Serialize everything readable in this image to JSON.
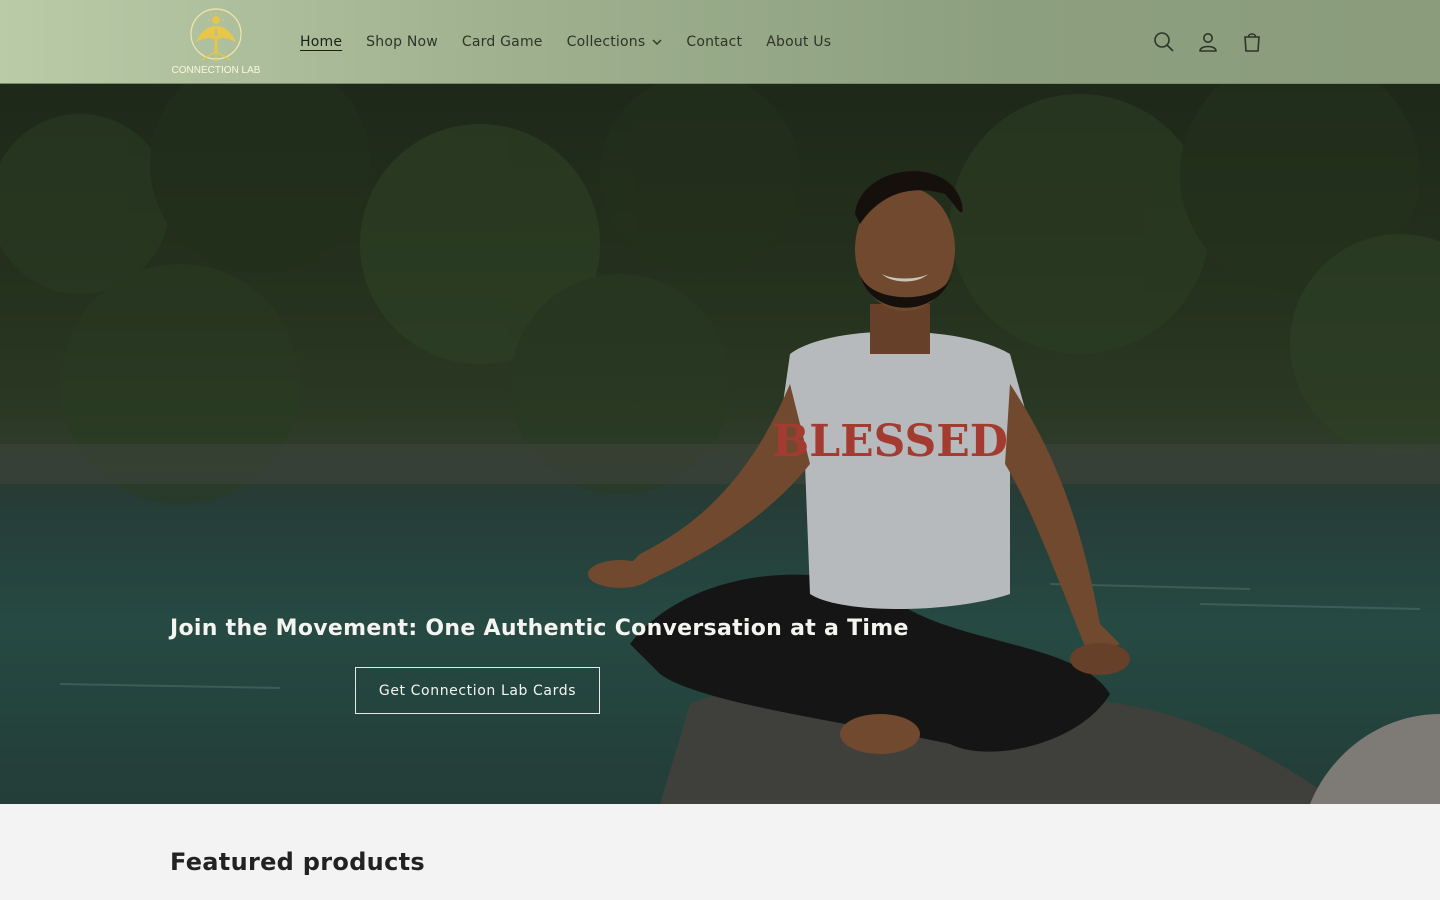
{
  "header": {
    "logo_text": "CONNECTION LAB",
    "nav": [
      {
        "label": "Home",
        "active": true
      },
      {
        "label": "Shop Now"
      },
      {
        "label": "Card Game"
      },
      {
        "label": "Collections",
        "has_dropdown": true
      },
      {
        "label": "Contact"
      },
      {
        "label": "About Us"
      }
    ],
    "icons": [
      "search-icon",
      "account-icon",
      "cart-icon"
    ]
  },
  "hero": {
    "heading": "Join the Movement: One Authentic Conversation at a Time",
    "button_label": "Get Connection Lab Cards",
    "shirt_text": "BLESSED"
  },
  "featured": {
    "title": "Featured products"
  },
  "colors": {
    "header_bg": "#9fb18f",
    "logo_gold": "#e7c64a",
    "hero_text": "#f4f4f0",
    "page_bg": "#f3f3f3"
  }
}
